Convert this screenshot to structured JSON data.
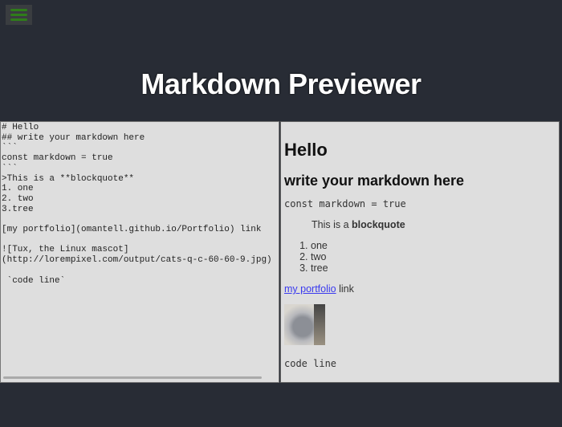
{
  "header": {
    "title": "Markdown Previewer",
    "menu_icon": "hamburger-icon"
  },
  "editor": {
    "text": "# Hello\n## write your markdown here\n```\nconst markdown = true\n```\n>This is a **blockquote**\n1. one\n2. two\n3.tree\n\n[my portfolio](omantell.github.io/Portfolio) link\n\n![Tux, the Linux mascot]\n(http://lorempixel.com/output/cats-q-c-60-60-9.jpg)\n\n `code line`"
  },
  "preview": {
    "h1": "Hello",
    "h2": "write your markdown here",
    "code": "const markdown = true",
    "blockquote_prefix": "This is a ",
    "blockquote_bold": "blockquote",
    "list": [
      "one",
      "two",
      "tree"
    ],
    "link_text": "my portfolio",
    "link_suffix": " link",
    "image_alt": "Tux, the Linux mascot",
    "code_line": "code line"
  }
}
